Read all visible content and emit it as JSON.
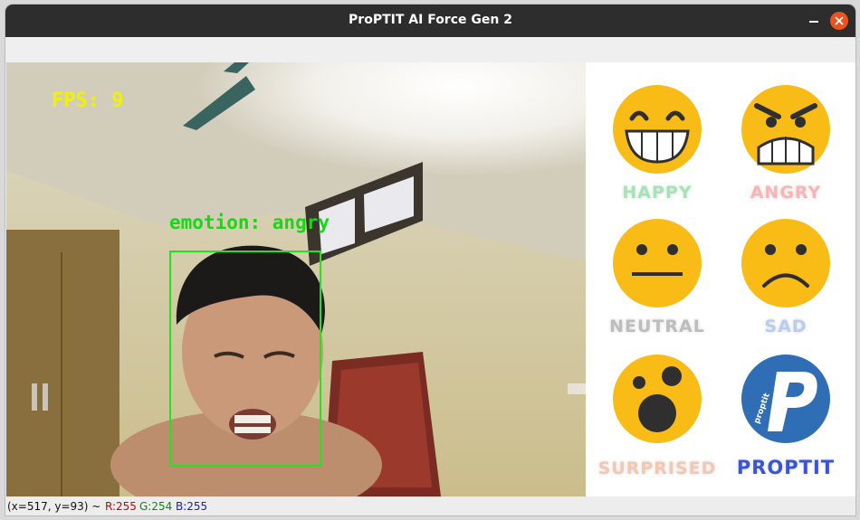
{
  "window": {
    "title": "ProPTIT AI Force Gen 2"
  },
  "overlay": {
    "fps": "FPS: 9",
    "emotion": "emotion: angry"
  },
  "panel": {
    "items": [
      {
        "label": "HAPPY",
        "color": "#a7e3b8"
      },
      {
        "label": "ANGRY",
        "color": "#f7b5b5"
      },
      {
        "label": "NEUTRAL",
        "color": "#bdbdbd"
      },
      {
        "label": "SAD",
        "color": "#b9cdf1"
      },
      {
        "label": "SURPRISED",
        "color": "#f3c8b3"
      },
      {
        "label": "PROPTIT",
        "color": "#3a55d6"
      }
    ],
    "logo_text": "proptit"
  },
  "status": {
    "coords": "(x=517, y=93) ~",
    "r": "R:255",
    "g": "G:254",
    "b": "B:255"
  },
  "colors": {
    "emoji_yellow": "#f9bb16",
    "emoji_dark": "#2f2f2f",
    "proptit_blue": "#2f6db5"
  }
}
